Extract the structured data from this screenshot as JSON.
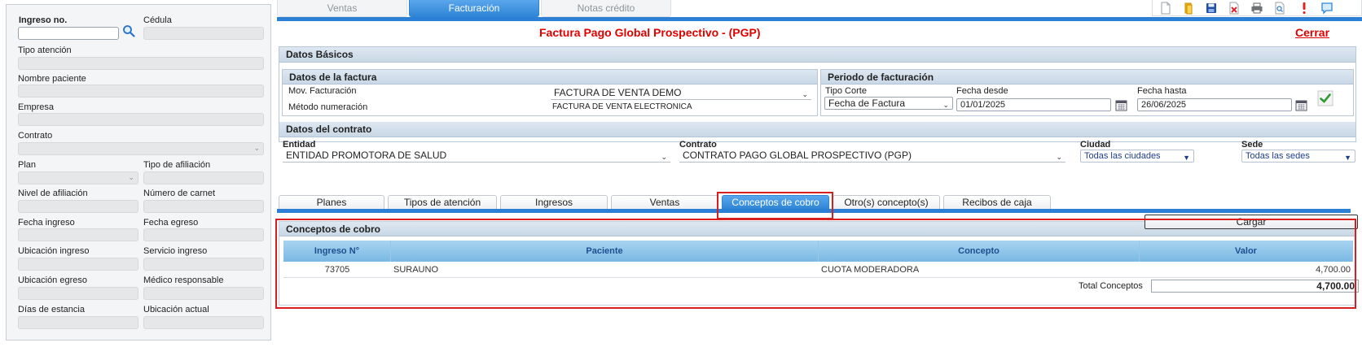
{
  "patient_panel": {
    "admission_no_label": "Ingreso no.",
    "admission_no_value": "",
    "id_label": "Cédula",
    "care_type_label": "Tipo atención",
    "patient_name_label": "Nombre paciente",
    "company_label": "Empresa",
    "contract_label": "Contrato",
    "plan_label": "Plan",
    "affiliation_type_label": "Tipo de afiliación",
    "affiliation_level_label": "Nivel de afiliación",
    "card_number_label": "Número de carnet",
    "admission_date_label": "Fecha ingreso",
    "discharge_date_label": "Fecha egreso",
    "admission_location_label": "Ubicación ingreso",
    "admission_service_label": "Servicio ingreso",
    "discharge_location_label": "Ubicación egreso",
    "responsible_doctor_label": "Médico responsable",
    "stay_days_label": "Días de estancia",
    "current_location_label": "Ubicación actual"
  },
  "top_tabs": {
    "sales": "Ventas",
    "billing": "Facturación",
    "credit_notes": "Notas crédito"
  },
  "toolbar_icons": [
    "new-document-icon",
    "open-folder-icon",
    "save-icon",
    "delete-icon",
    "print-icon",
    "preview-icon",
    "alert-icon",
    "help-chat-icon"
  ],
  "page": {
    "title": "Factura Pago Global Prospectivo - (PGP)",
    "close_label": "Cerrar"
  },
  "basic_data": {
    "header": "Datos Básicos",
    "invoice": {
      "header": "Datos de la factura",
      "movement_label": "Mov. Facturación",
      "movement_value": "FACTURA DE VENTA DEMO",
      "numbering_label": "Método numeración",
      "numbering_value": "FACTURA DE VENTA ELECTRONICA"
    },
    "period": {
      "header": "Periodo de facturación",
      "cut_type_label": "Tipo Corte",
      "cut_type_value": "Fecha de Factura",
      "date_from_label": "Fecha desde",
      "date_from_value": "01/01/2025",
      "date_to_label": "Fecha hasta",
      "date_to_value": "26/06/2025"
    }
  },
  "contract_data": {
    "header": "Datos del contrato",
    "entity_label": "Entidad",
    "entity_value": "ENTIDAD PROMOTORA DE SALUD",
    "contract_label": "Contrato",
    "contract_value": "CONTRATO PAGO GLOBAL PROSPECTIVO (PGP)",
    "city_label": "Ciudad",
    "city_value": "Todas las ciudades",
    "site_label": "Sede",
    "site_value": "Todas las sedes"
  },
  "sub_tabs": [
    "Planes",
    "Tipos de atención",
    "Ingresos",
    "Ventas",
    "Conceptos de cobro",
    "Otro(s) concepto(s)",
    "Recibos de caja"
  ],
  "charges": {
    "header": "Conceptos de cobro",
    "load_label": "Cargar",
    "columns": [
      "Ingreso N°",
      "Paciente",
      "Concepto",
      "Valor"
    ],
    "rows": [
      {
        "admission": "73705",
        "patient": "SURAUNO",
        "concept": "CUOTA MODERADORA",
        "value": "4,700.00"
      }
    ],
    "total_label": "Total Conceptos",
    "total_value": "4,700.00"
  }
}
